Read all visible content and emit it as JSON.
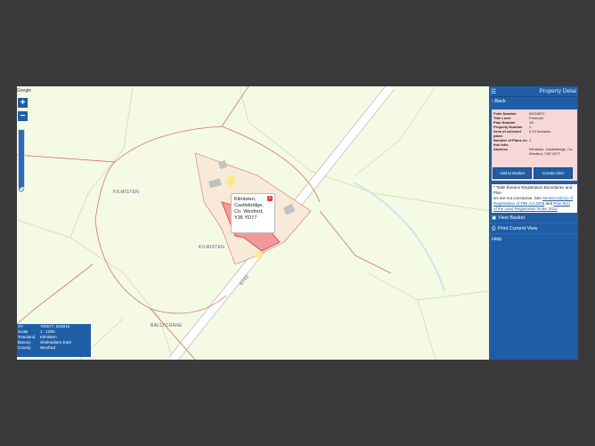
{
  "map": {
    "attribution": "Google",
    "zoom_in": "+",
    "zoom_out": "−",
    "rotate_symbol": "↻",
    "labels": {
      "road": "R742",
      "townland_left": "KILMISTEN",
      "townland_center": "KILMISTEN",
      "townland_bottom": "BALLYCRANE"
    },
    "popup": {
      "lines": [
        "Kilmisten,",
        "Castlebridge,",
        "Co. Wexford,",
        "Y35 YD77"
      ],
      "pin_symbol": "×"
    },
    "colors": {
      "background": "#f5fae4",
      "boundary": "#d2736b",
      "parcel_fill": "#f29a9a",
      "highlight": "#fde98c",
      "road": "#ffffff",
      "water": "#cfe3ef"
    }
  },
  "coords_panel": {
    "rows": [
      {
        "key": "XY",
        "value": "706577, 625819"
      },
      {
        "key": "Scale",
        "value": "1 : 1000"
      },
      {
        "key": "Townland",
        "value": "Kilmisten"
      },
      {
        "key": "Barony",
        "value": "Shelmaliere East"
      },
      {
        "key": "County",
        "value": "Wexford"
      }
    ]
  },
  "panel": {
    "menu_icon": "☰",
    "title": "Property Detai",
    "back_label": "Back",
    "details": [
      {
        "key": "Folio Number",
        "value": "WX18571"
      },
      {
        "key": "Title Level",
        "value": "Freehold"
      },
      {
        "key": "Plan Number",
        "value": "1A"
      },
      {
        "key": "Property Number",
        "value": "1"
      },
      {
        "key": "Area of selected plans",
        "value": "0.13 hectares"
      },
      {
        "key": "Number of Plans on this folio",
        "value": "1"
      },
      {
        "key": "Address",
        "value": "Kilmisten, Castlebridge, Co. Wexford, Y35 YD77"
      }
    ],
    "add_to_basket": "Add to Basket",
    "create_alert": "Create Alert",
    "notice_lines": {
      "l1": "* Tailte Éireann Registration Boundaries and Plan",
      "l2a": "ies are not conclusive. See ",
      "l2link": "Section 62(11) of",
      "l3link": "Registration of Title Act 2006",
      "l3b": " and ",
      "l3link2": "Rule 8(1)",
      "l4link": "of the Land Registration Rules 2012"
    },
    "view_basket": "View Basket",
    "print_view": "Print Current View",
    "help": "Help"
  }
}
